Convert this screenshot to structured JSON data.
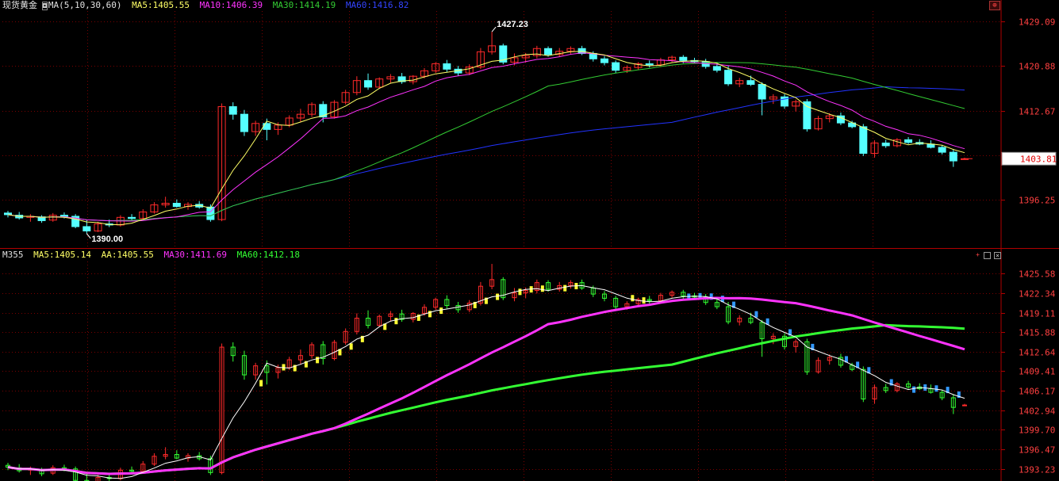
{
  "colors": {
    "background": "#000000",
    "grid": "#7a0000",
    "up": "#ff2a2a",
    "down": "#55ffff",
    "ma5": "#ffff66",
    "ma10": "#ff33ff",
    "ma30": "#33cc33",
    "ma60": "#2233ff",
    "axis_text": "#ff4040"
  },
  "top_panel": {
    "instrument": "现货黄金",
    "indicator_name": "MA(5,10,30,60)",
    "ma5_label": "MA5:1405.55",
    "ma10_label": "MA10:1406.39",
    "ma30_label": "MA30:1414.19",
    "ma60_label": "MA60:1416.82",
    "high_label": "1427.23",
    "low_label": "1390.00",
    "current_price": "1403.81",
    "y_ticks": [
      "1429.09",
      "1420.88",
      "1412.67",
      "1404.46",
      "1396.25"
    ]
  },
  "bottom_panel": {
    "indicator_name": "M355",
    "ma5_label": "MA5:1405.14",
    "aa_label": "AA:1405.55",
    "ma30_label": "MA30:1411.69",
    "ma60_label": "MA60:1412.18",
    "y_ticks": [
      "1425.58",
      "1422.34",
      "1419.11",
      "1415.88",
      "1412.64",
      "1409.41",
      "1406.17",
      "1402.94",
      "1399.70",
      "1396.47",
      "1393.23"
    ]
  },
  "chart_data": {
    "type": "candlestick",
    "title": "现货黄金",
    "price_range_top": [
      1387.5,
      1431.0
    ],
    "price_range_bottom": [
      1391.2,
      1427.6
    ],
    "candles": [
      [
        1393.8,
        1394.2,
        1393.0,
        1393.5
      ],
      [
        1393.4,
        1394.0,
        1392.6,
        1392.9
      ],
      [
        1393.0,
        1393.6,
        1392.2,
        1393.2
      ],
      [
        1393.1,
        1393.4,
        1392.0,
        1392.4
      ],
      [
        1392.5,
        1393.8,
        1392.2,
        1393.4
      ],
      [
        1393.4,
        1393.9,
        1392.8,
        1393.2
      ],
      [
        1393.2,
        1393.6,
        1391.0,
        1391.3
      ],
      [
        1391.3,
        1392.5,
        1390.0,
        1390.5
      ],
      [
        1390.5,
        1392.2,
        1390.3,
        1391.8
      ],
      [
        1391.8,
        1392.6,
        1391.2,
        1391.6
      ],
      [
        1391.6,
        1393.4,
        1391.3,
        1393.0
      ],
      [
        1393.0,
        1393.6,
        1392.4,
        1392.8
      ],
      [
        1392.8,
        1394.5,
        1392.5,
        1394.0
      ],
      [
        1394.0,
        1395.8,
        1393.7,
        1395.3
      ],
      [
        1395.3,
        1396.8,
        1394.8,
        1395.6
      ],
      [
        1395.6,
        1396.3,
        1394.8,
        1395.0
      ],
      [
        1395.0,
        1395.8,
        1394.4,
        1395.4
      ],
      [
        1395.4,
        1396.0,
        1394.6,
        1394.9
      ],
      [
        1394.9,
        1395.4,
        1392.2,
        1392.6
      ],
      [
        1392.6,
        1414.0,
        1392.3,
        1413.4
      ],
      [
        1413.4,
        1414.2,
        1411.0,
        1412.0
      ],
      [
        1412.0,
        1412.8,
        1408.0,
        1408.8
      ],
      [
        1408.8,
        1410.8,
        1408.0,
        1410.3
      ],
      [
        1410.3,
        1411.2,
        1407.2,
        1409.2
      ],
      [
        1409.2,
        1410.5,
        1408.2,
        1410.0
      ],
      [
        1410.0,
        1411.8,
        1409.6,
        1411.3
      ],
      [
        1411.3,
        1413.0,
        1410.5,
        1412.0
      ],
      [
        1412.0,
        1414.2,
        1411.5,
        1413.8
      ],
      [
        1413.8,
        1414.4,
        1410.5,
        1411.5
      ],
      [
        1411.5,
        1414.6,
        1411.2,
        1414.2
      ],
      [
        1414.2,
        1416.5,
        1413.8,
        1416.0
      ],
      [
        1416.0,
        1419.0,
        1415.5,
        1418.2
      ],
      [
        1418.2,
        1419.5,
        1416.5,
        1417.0
      ],
      [
        1417.0,
        1418.8,
        1416.7,
        1418.5
      ],
      [
        1418.5,
        1419.4,
        1417.7,
        1418.9
      ],
      [
        1418.9,
        1419.6,
        1417.6,
        1418.0
      ],
      [
        1418.0,
        1419.2,
        1417.5,
        1419.0
      ],
      [
        1419.0,
        1420.5,
        1418.6,
        1420.0
      ],
      [
        1420.0,
        1421.6,
        1419.6,
        1421.3
      ],
      [
        1421.3,
        1422.0,
        1419.8,
        1420.3
      ],
      [
        1420.3,
        1420.9,
        1419.1,
        1419.6
      ],
      [
        1419.6,
        1421.2,
        1419.2,
        1420.7
      ],
      [
        1420.7,
        1424.2,
        1420.3,
        1423.5
      ],
      [
        1423.5,
        1427.2,
        1423.0,
        1424.6
      ],
      [
        1424.6,
        1425.0,
        1421.2,
        1421.6
      ],
      [
        1421.6,
        1423.2,
        1421.0,
        1422.4
      ],
      [
        1422.4,
        1423.3,
        1421.5,
        1422.8
      ],
      [
        1422.8,
        1424.6,
        1422.3,
        1424.1
      ],
      [
        1424.1,
        1424.5,
        1422.6,
        1423.0
      ],
      [
        1423.0,
        1424.2,
        1422.6,
        1423.6
      ],
      [
        1423.6,
        1424.5,
        1423.1,
        1424.1
      ],
      [
        1424.1,
        1424.6,
        1422.9,
        1423.2
      ],
      [
        1423.2,
        1423.6,
        1421.7,
        1422.2
      ],
      [
        1422.2,
        1422.7,
        1421.0,
        1421.5
      ],
      [
        1421.5,
        1421.9,
        1419.6,
        1420.1
      ],
      [
        1420.1,
        1421.0,
        1419.6,
        1420.6
      ],
      [
        1420.6,
        1421.6,
        1420.2,
        1421.3
      ],
      [
        1421.3,
        1421.9,
        1420.6,
        1421.1
      ],
      [
        1421.1,
        1422.4,
        1420.7,
        1422.0
      ],
      [
        1422.0,
        1422.8,
        1421.6,
        1422.5
      ],
      [
        1422.5,
        1422.9,
        1421.4,
        1421.9
      ],
      [
        1421.9,
        1422.4,
        1421.3,
        1421.7
      ],
      [
        1421.7,
        1422.2,
        1420.4,
        1420.8
      ],
      [
        1420.8,
        1421.5,
        1419.7,
        1420.1
      ],
      [
        1420.1,
        1420.9,
        1417.2,
        1417.6
      ],
      [
        1417.6,
        1418.7,
        1417.0,
        1418.2
      ],
      [
        1418.2,
        1419.1,
        1417.2,
        1417.5
      ],
      [
        1417.5,
        1417.9,
        1411.8,
        1414.8
      ],
      [
        1414.8,
        1415.7,
        1413.9,
        1415.2
      ],
      [
        1415.2,
        1415.7,
        1413.0,
        1413.5
      ],
      [
        1413.5,
        1414.7,
        1412.5,
        1414.3
      ],
      [
        1414.3,
        1414.8,
        1408.8,
        1409.3
      ],
      [
        1409.3,
        1411.7,
        1409.0,
        1411.2
      ],
      [
        1411.2,
        1412.2,
        1410.5,
        1411.7
      ],
      [
        1411.7,
        1412.3,
        1410.0,
        1410.4
      ],
      [
        1410.4,
        1410.8,
        1409.4,
        1409.7
      ],
      [
        1409.7,
        1410.2,
        1404.3,
        1404.8
      ],
      [
        1404.8,
        1407.2,
        1404.0,
        1406.7
      ],
      [
        1406.7,
        1407.3,
        1405.8,
        1406.2
      ],
      [
        1406.2,
        1407.6,
        1405.9,
        1407.3
      ],
      [
        1407.3,
        1407.8,
        1406.5,
        1406.8
      ],
      [
        1406.8,
        1407.4,
        1406.3,
        1406.5
      ],
      [
        1406.5,
        1407.2,
        1405.7,
        1405.9
      ],
      [
        1405.9,
        1406.3,
        1404.6,
        1405.0
      ],
      [
        1405.0,
        1405.6,
        1402.3,
        1403.4
      ],
      [
        1403.8,
        1404.0,
        1403.6,
        1403.8
      ]
    ]
  }
}
